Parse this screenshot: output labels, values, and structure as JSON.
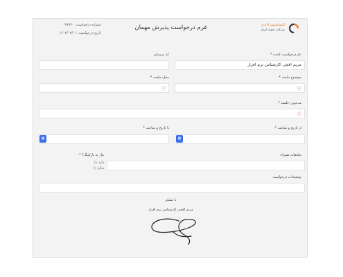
{
  "header": {
    "title": "فرم درخواست پذیرش مهمان",
    "request_number": "شماره درخواست: ۶۷۷۶۰",
    "request_date": "تاریخ درخواست: ۱۴۰۳/۰۳/۰۱",
    "logo_line1": "اتوماسیون اداری",
    "logo_line2": "شرکت نمونه ایران"
  },
  "fields": {
    "requester_label": "نام درخواست کننده",
    "requester_value": "مریم افچی کارشناس نرم افزار",
    "personnel_label": "کد پرسنلی",
    "personnel_value": "",
    "subject_label": "موضوع جلسه",
    "location_label": "محل جلسه",
    "invitees_label": "مدعوین جلسه",
    "from_label": "از تاریخ و ساعت",
    "to_label": "تا تاریخ و ساعت",
    "attachments_label": "ملحقات همراه",
    "parking_label": "نیاز به پارکینگ؟",
    "parking_options": [
      "دارد",
      "ندارد"
    ],
    "description_label": "توضیحات درخواست",
    "required_mark": "*",
    "warn_symbol": "ⓘ"
  },
  "footer": {
    "thanks": "با تشکر",
    "signer": "مریم افچی کارشناس نرم افزار"
  },
  "icons": {
    "calendar": "calendar-icon",
    "logo": "logo-icon",
    "warning": "warning-icon"
  },
  "colors": {
    "accent": "#3b6ff0",
    "logo_orange": "#e8731f",
    "required": "#cc0000"
  }
}
